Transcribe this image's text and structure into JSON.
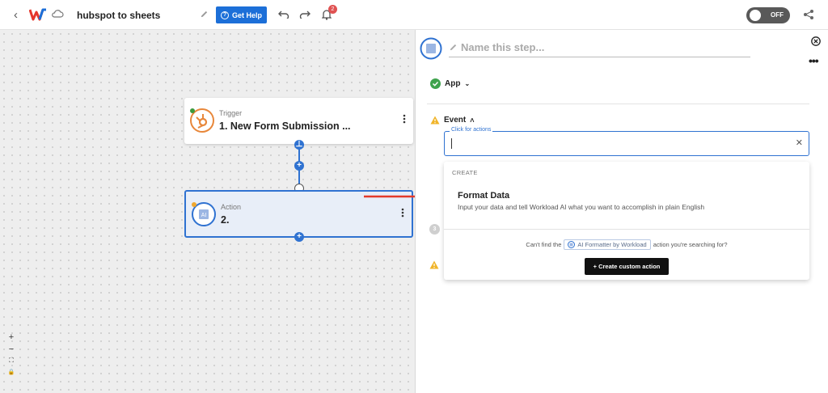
{
  "app": {
    "title": "hubspot to sheets",
    "help_label": "Get Help",
    "notifications_count": "2",
    "toggle_label": "OFF",
    "brand_color": "#1c6fd8"
  },
  "canvas": {
    "trigger": {
      "type": "Trigger",
      "title": "1. New Form Submission ..."
    },
    "action": {
      "type": "Action",
      "title": "2."
    },
    "zoom": {
      "in": "+",
      "out": "−",
      "fit": "⛶",
      "lock": "🔒"
    }
  },
  "panel": {
    "name_placeholder": "Name this step...",
    "app_label": "App",
    "event_label": "Event",
    "field_legend": "Click for actions",
    "dropdown": {
      "group": "CREATE",
      "option_title": "Format Data",
      "option_desc": "Input your data and tell Workload AI what you want to accomplish in plain English",
      "cant_find_prefix": "Can't find the",
      "chip_label": "AI Formatter by Workload",
      "cant_find_suffix": "action you're searching for?",
      "custom_button": "+ Create custom action"
    },
    "step_number": "3"
  }
}
